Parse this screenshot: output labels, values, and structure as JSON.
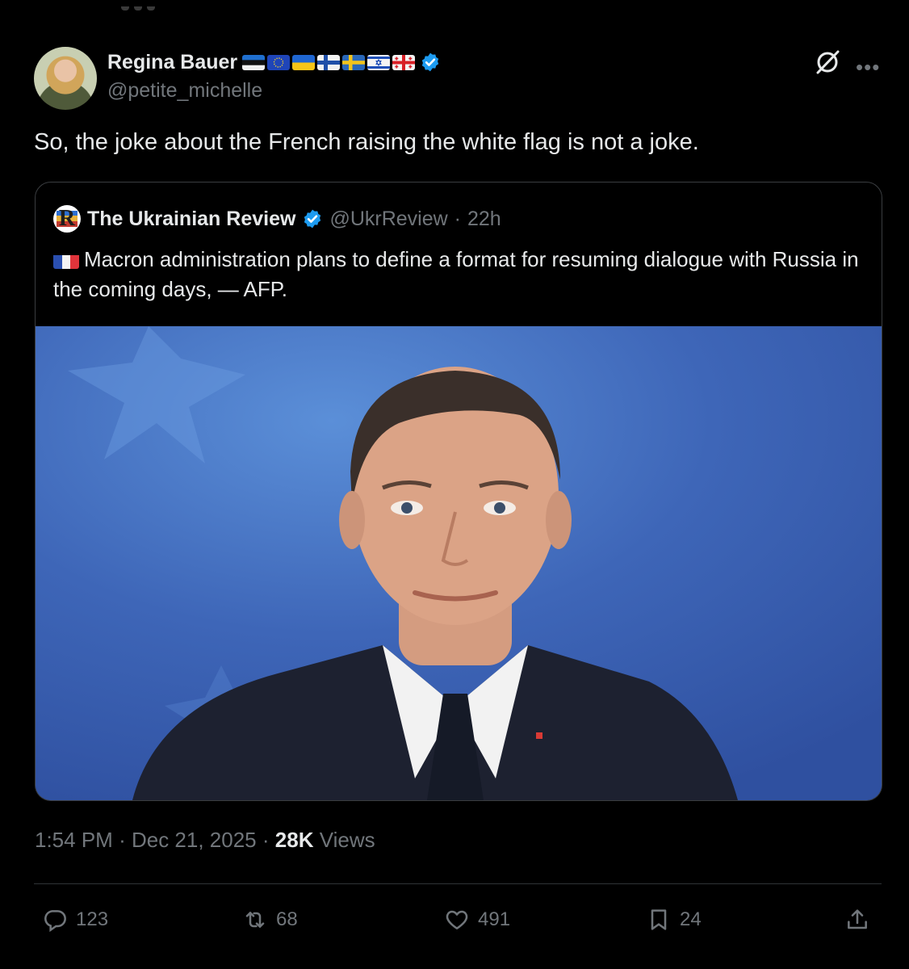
{
  "author": {
    "display_name": "Regina Bauer",
    "handle": "@petite_michelle",
    "flags": [
      "estonia-flag",
      "eu-flag",
      "ukraine-flag",
      "finland-flag",
      "sweden-flag",
      "israel-flag",
      "georgia-flag"
    ],
    "verified": true
  },
  "tweet": {
    "text": "So, the joke about the French raising the white flag is not a joke."
  },
  "quoted": {
    "display_name": "The Ukrainian Review",
    "handle": "@UkrReview",
    "separator": "·",
    "age": "22h",
    "flag": "france-flag",
    "text": "Macron administration plans to define a format for resuming dialogue with Russia in the coming days, — AFP.",
    "logo_letter": "R"
  },
  "meta": {
    "time": "1:54 PM",
    "dot1": "·",
    "date": "Dec 21, 2025",
    "dot2": "·",
    "views_count": "28K",
    "views_label": "Views"
  },
  "actions": {
    "replies": "123",
    "reposts": "68",
    "likes": "491",
    "bookmarks": "24"
  },
  "colors": {
    "background": "#000000",
    "text": "#e7e9ea",
    "secondary": "#71767b",
    "verified_blue": "#1d9bf0",
    "image_blue": "#3e66b8"
  }
}
